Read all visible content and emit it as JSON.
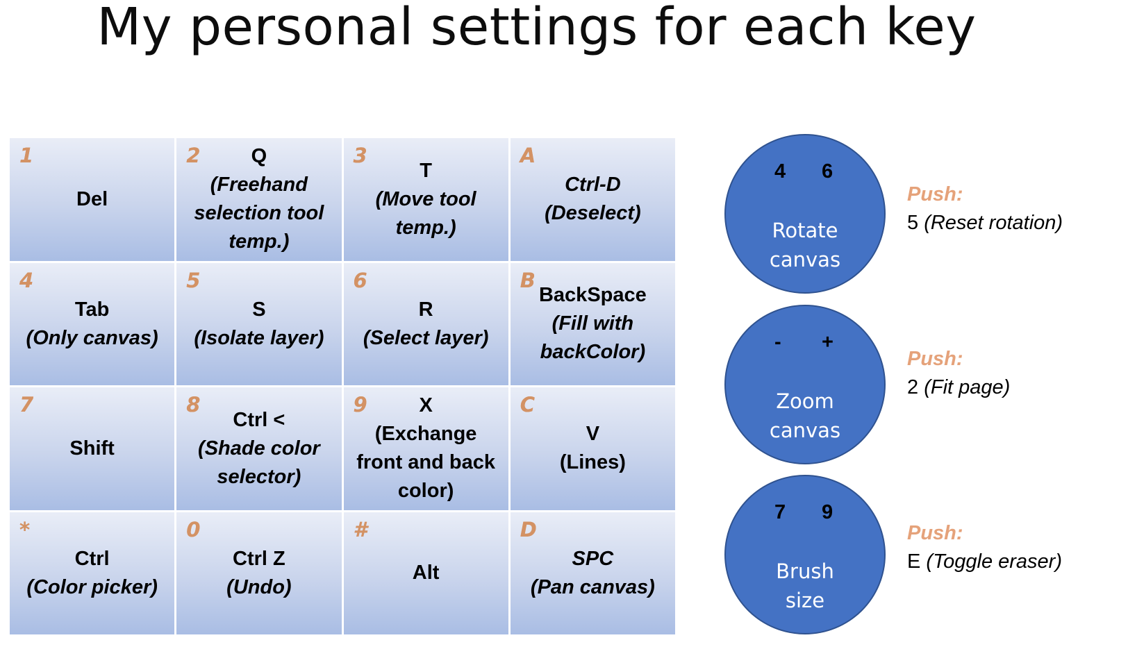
{
  "title": "My personal settings for each key",
  "keys": [
    {
      "num": "1",
      "key": "",
      "action": "Del",
      "italic": false
    },
    {
      "num": "2",
      "key": "Q",
      "action": "(Freehand\nselection tool\ntemp.)",
      "italic": true
    },
    {
      "num": "3",
      "key": "T",
      "action": "(Move tool\ntemp.)",
      "italic": true
    },
    {
      "num": "A",
      "key": "",
      "action": "Ctrl-D\n(Deselect)",
      "italic": true
    },
    {
      "num": "4",
      "key": "Tab",
      "action": "(Only canvas)",
      "italic": true
    },
    {
      "num": "5",
      "key": "S",
      "action": "(Isolate layer)",
      "italic": true
    },
    {
      "num": "6",
      "key": "R",
      "action": "(Select layer)",
      "italic": true
    },
    {
      "num": "B",
      "key": "BackSpace",
      "action": "(Fill with\nbackColor)",
      "italic": true
    },
    {
      "num": "7",
      "key": "",
      "action": "Shift",
      "italic": false
    },
    {
      "num": "8",
      "key": "Ctrl <",
      "action": "(Shade color\nselector)",
      "italic": true
    },
    {
      "num": "9",
      "key": "X",
      "action": "(Exchange\nfront and back\ncolor)",
      "italic": false
    },
    {
      "num": "C",
      "key": "V",
      "action": "(Lines)",
      "italic": false
    },
    {
      "num": "*",
      "key": "Ctrl",
      "action": "(Color picker)",
      "italic": true
    },
    {
      "num": "0",
      "key": "Ctrl Z",
      "action": "(Undo)",
      "italic": true
    },
    {
      "num": "#",
      "key": "",
      "action": "Alt",
      "italic": false
    },
    {
      "num": "D",
      "key": "SPC",
      "action": "(Pan canvas)",
      "italic": true
    }
  ],
  "wheels": [
    {
      "left": "4",
      "right": "6",
      "label": "Rotate\ncanvas",
      "push_label": "Push:",
      "push_key": "5",
      "push_action": "(Reset rotation)"
    },
    {
      "left": "-",
      "right": "+",
      "label": "Zoom\ncanvas",
      "push_label": "Push:",
      "push_key": "2",
      "push_action": "(Fit page)"
    },
    {
      "left": "7",
      "right": "9",
      "label": "Brush\nsize",
      "push_label": "Push:",
      "push_key": "E",
      "push_action": "(Toggle eraser)"
    }
  ],
  "colors": {
    "wheel_fill": "#4472c4",
    "wheel_border": "#2f528f",
    "cell_top": "#e9edf7",
    "cell_bottom": "#a9bde4",
    "accent_orange": "#e5a27a"
  }
}
